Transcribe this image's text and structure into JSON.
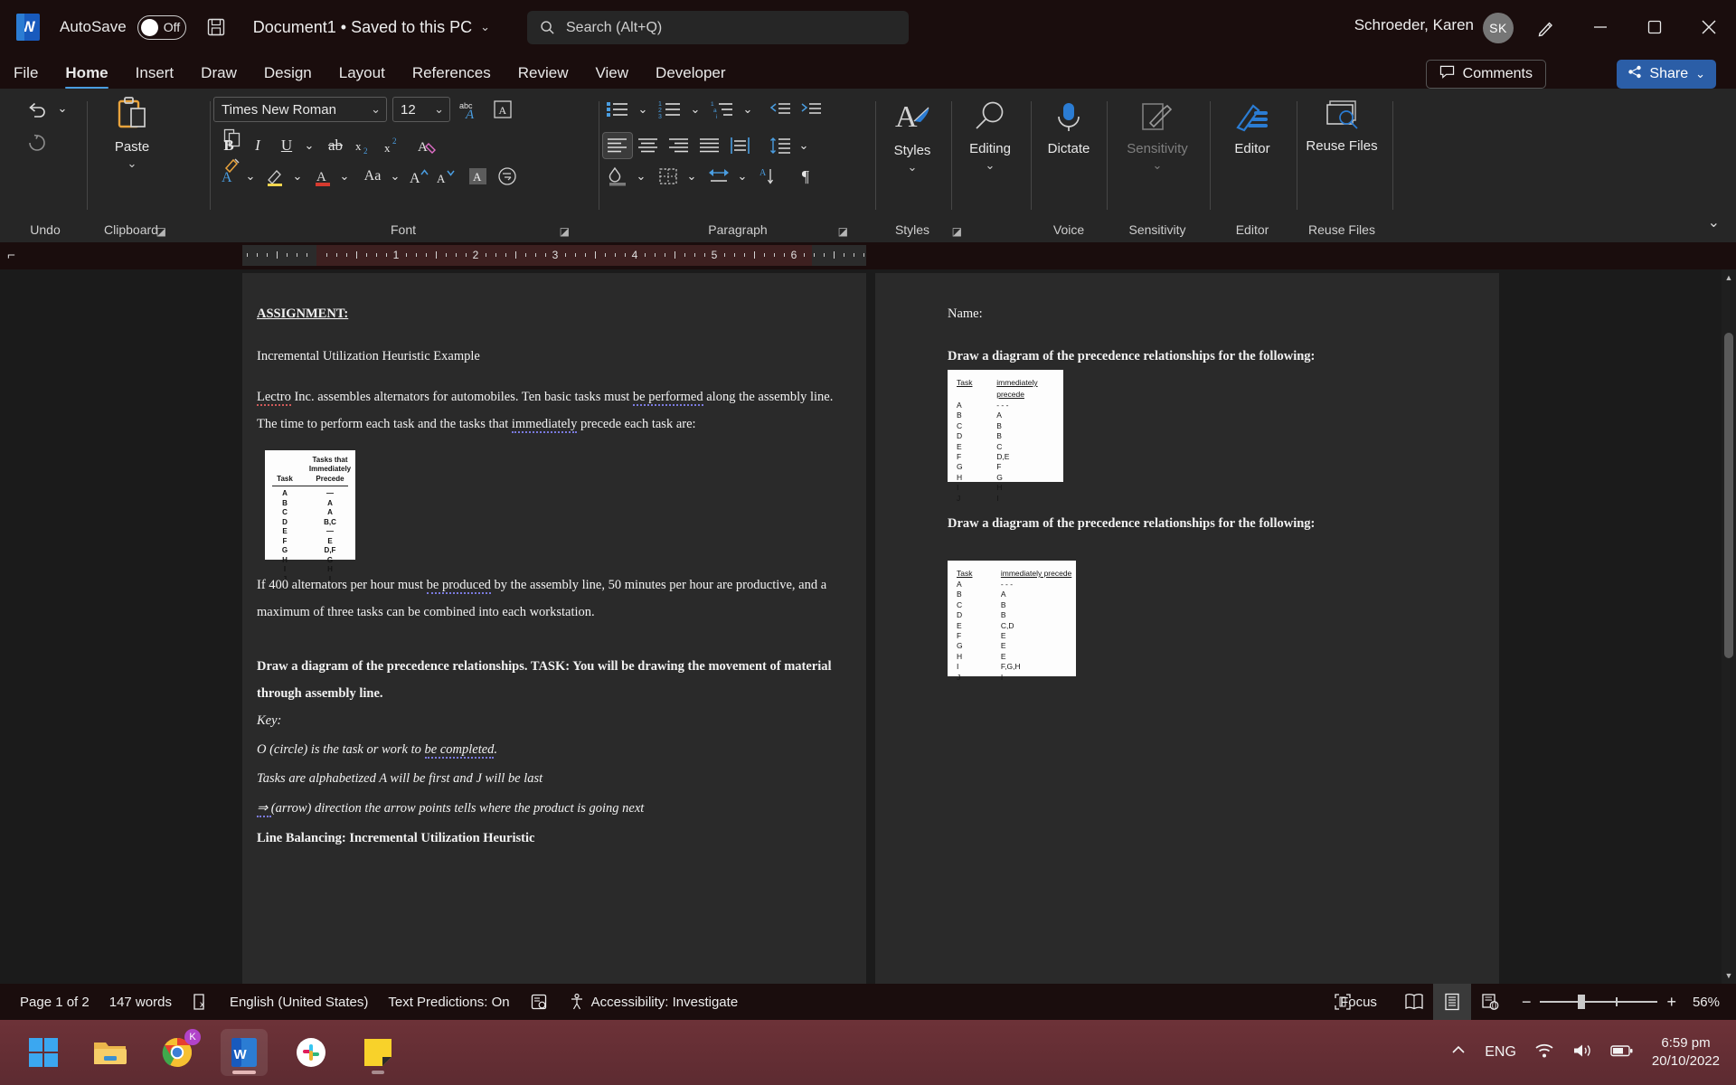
{
  "titlebar": {
    "app_logo": "word-logo",
    "autosave_label": "AutoSave",
    "autosave_state": "Off",
    "save_icon": "save-icon",
    "document_title": "Document1 • Saved to this PC",
    "search_placeholder": "Search (Alt+Q)",
    "user_name": "Schroeder, Karen",
    "user_initials": "SK",
    "pen_icon": "pen-icon",
    "minimize": "minimize-icon",
    "maximize": "maximize-icon",
    "close": "close-icon"
  },
  "tabs": [
    {
      "label": "File",
      "active": false
    },
    {
      "label": "Home",
      "active": true
    },
    {
      "label": "Insert",
      "active": false
    },
    {
      "label": "Draw",
      "active": false
    },
    {
      "label": "Design",
      "active": false
    },
    {
      "label": "Layout",
      "active": false
    },
    {
      "label": "References",
      "active": false
    },
    {
      "label": "Review",
      "active": false
    },
    {
      "label": "View",
      "active": false
    },
    {
      "label": "Developer",
      "active": false
    }
  ],
  "tab_actions": {
    "comments_label": "Comments",
    "share_label": "Share"
  },
  "ribbon": {
    "groups": [
      {
        "name": "Undo",
        "label": "Undo"
      },
      {
        "name": "Clipboard",
        "label": "Clipboard",
        "paste_label": "Paste"
      },
      {
        "name": "Font",
        "label": "Font"
      },
      {
        "name": "Paragraph",
        "label": "Paragraph"
      },
      {
        "name": "Styles",
        "label": "Styles",
        "big_label": "Styles"
      },
      {
        "name": "Voice",
        "label": "Voice",
        "big_label": "Dictate"
      },
      {
        "name": "Sensitivity",
        "label": "Sensitivity",
        "big_label": "Sensitivity"
      },
      {
        "name": "Editor",
        "label": "Editor",
        "big_label": "Editor"
      },
      {
        "name": "ReuseFiles",
        "label": "Reuse Files",
        "big_label": "Reuse Files"
      }
    ],
    "editing_label": "Editing",
    "font_name": "Times New Roman",
    "font_size": "12"
  },
  "ruler": {
    "numbers": [
      "1",
      "2",
      "3",
      "4",
      "5",
      "6"
    ]
  },
  "document": {
    "left_page": {
      "heading": "ASSIGNMENT:",
      "subtitle": "Incremental Utilization Heuristic Example",
      "para1_a": "Lectro",
      "para1_b": " Inc. assembles alternators for automobiles.  Ten basic tasks must ",
      "para1_c": "be performed",
      "para1_d": " along the assembly line.  The time to perform each task and the tasks that ",
      "para1_e": "immediately",
      "para1_f": " precede each task are:",
      "para2_a": "If 400 alternators per hour must ",
      "para2_b": "be produced",
      "para2_c": " by the assembly line, 50 minutes per hour are productive, and a maximum of three tasks can be combined into each workstation.",
      "para3": "Draw a diagram of the precedence relationships.  TASK: You will be drawing the movement of material through assembly line.",
      "key_label": "Key:",
      "key1_a": "O (circle) is the task or work to ",
      "key1_b": "be completed",
      "key1_c": ".",
      "key2": "Tasks are alphabetized A will be first and J will be last",
      "key3_a": "⇒ ",
      "key3_b": "(arrow) direction the arrow points tells where the product is going next",
      "footer": "Line Balancing: Incremental Utilization Heuristic",
      "table1": {
        "header_lines": [
          "Tasks that",
          "Immediately",
          "Precede"
        ],
        "col1_header": "Task",
        "rows": [
          [
            "A",
            "—"
          ],
          [
            "B",
            "A"
          ],
          [
            "C",
            "A"
          ],
          [
            "D",
            "B,C"
          ],
          [
            "E",
            "—"
          ],
          [
            "F",
            "E"
          ],
          [
            "G",
            "D,F"
          ],
          [
            "H",
            "G"
          ],
          [
            "I",
            "H"
          ],
          [
            "J",
            "I"
          ]
        ]
      }
    },
    "right_page": {
      "name_label": "Name:",
      "prompt1": "Draw a diagram of the precedence relationships for the following:",
      "prompt2": "Draw a diagram of the precedence relationships for the following:",
      "table2": {
        "col1_header": "Task",
        "col2_header": "immediately precede",
        "rows": [
          [
            "A",
            "- - -"
          ],
          [
            "B",
            "A"
          ],
          [
            "C",
            "B"
          ],
          [
            "D",
            "B"
          ],
          [
            "E",
            "C"
          ],
          [
            "F",
            "D,E"
          ],
          [
            "G",
            "F"
          ],
          [
            "H",
            "G"
          ],
          [
            "I",
            "H"
          ],
          [
            "J",
            "I"
          ]
        ]
      },
      "table3": {
        "col1_header": "Task",
        "col2_header": "immediately precede",
        "rows": [
          [
            "A",
            "- - -"
          ],
          [
            "B",
            "A"
          ],
          [
            "C",
            "B"
          ],
          [
            "D",
            "B"
          ],
          [
            "E",
            "C,D"
          ],
          [
            "F",
            "E"
          ],
          [
            "G",
            "E"
          ],
          [
            "H",
            "E"
          ],
          [
            "I",
            "F,G,H"
          ],
          [
            "J",
            "I"
          ]
        ]
      }
    }
  },
  "statusbar": {
    "page": "Page 1 of 2",
    "words": "147 words",
    "proofing_icon": "proofing-errors-icon",
    "language": "English (United States)",
    "text_predictions": "Text Predictions: On",
    "predictions_icon": "text-predictions-icon",
    "accessibility_icon": "accessibility-icon",
    "accessibility": "Accessibility: Investigate",
    "focus": "Focus",
    "view_read": "read-mode-icon",
    "view_print": "print-layout-icon",
    "view_web": "web-layout-icon",
    "zoom_out": "−",
    "zoom_in": "+",
    "zoom_level": "56%"
  },
  "taskbar": {
    "apps": [
      {
        "name": "start-button",
        "icon": "windows-logo"
      },
      {
        "name": "file-explorer",
        "icon": "folder-icon"
      },
      {
        "name": "google-chrome",
        "icon": "chrome-icon",
        "badge": "K"
      },
      {
        "name": "microsoft-word",
        "icon": "word-icon",
        "active": true
      },
      {
        "name": "slack",
        "icon": "slack-icon"
      },
      {
        "name": "sticky-notes",
        "icon": "sticky-notes-icon"
      }
    ],
    "tray": {
      "chevron": "show-hidden-icons",
      "language": "ENG",
      "wifi": "wifi-icon",
      "volume": "volume-icon",
      "battery": "battery-icon",
      "time": "6:59 pm",
      "date": "20/10/2022"
    }
  },
  "colors": {
    "accent": "#2B5EA7",
    "word_blue": "#185ABD",
    "taskbar": "#6d3238",
    "page_bg": "#2a2a2a"
  }
}
